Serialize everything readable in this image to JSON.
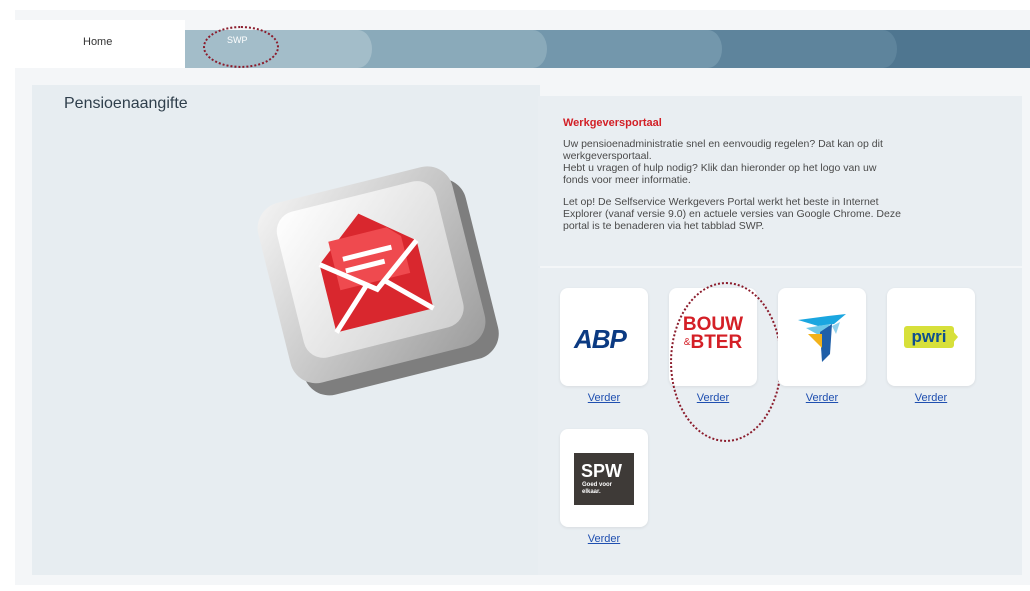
{
  "tabs": [
    {
      "label": "Home"
    },
    {
      "label": "SWP"
    }
  ],
  "left_panel": {
    "title": "Pensioenaangifte"
  },
  "portal": {
    "title": "Werkgeversportaal",
    "paragraph1_line1": "Uw pensioenadministratie snel en eenvoudig regelen? Dat kan op dit",
    "paragraph1_line2": "werkgeversportaal.",
    "paragraph1_line3": "Hebt u vragen of hulp nodig? Klik dan hieronder op het logo van uw",
    "paragraph1_line4": "fonds voor meer informatie.",
    "paragraph2_line1": "Let op! De Selfservice Werkgevers Portal werkt het beste in Internet",
    "paragraph2_line2": "Explorer (vanaf versie 9.0) en actuele versies van Google Chrome. Deze",
    "paragraph2_line3": "portal is te benaderen via het tabblad SWP."
  },
  "funds": [
    {
      "logo_text": "ABP",
      "link": "Verder"
    },
    {
      "logo_text_1": "BOUW",
      "logo_amp": "&",
      "logo_text_2": "BTER",
      "link": "Verder"
    },
    {
      "logo_icon": "bird-logo-icon",
      "link": "Verder"
    },
    {
      "logo_text": "pwri",
      "link": "Verder"
    },
    {
      "logo_text": "SPW",
      "tagline_1": "Goed voor",
      "tagline_2": "elkaar.",
      "link": "Verder"
    }
  ],
  "colors": {
    "accent_red": "#d21f26",
    "annotation": "#8b1c2c",
    "link_blue": "#1f4fb0"
  }
}
